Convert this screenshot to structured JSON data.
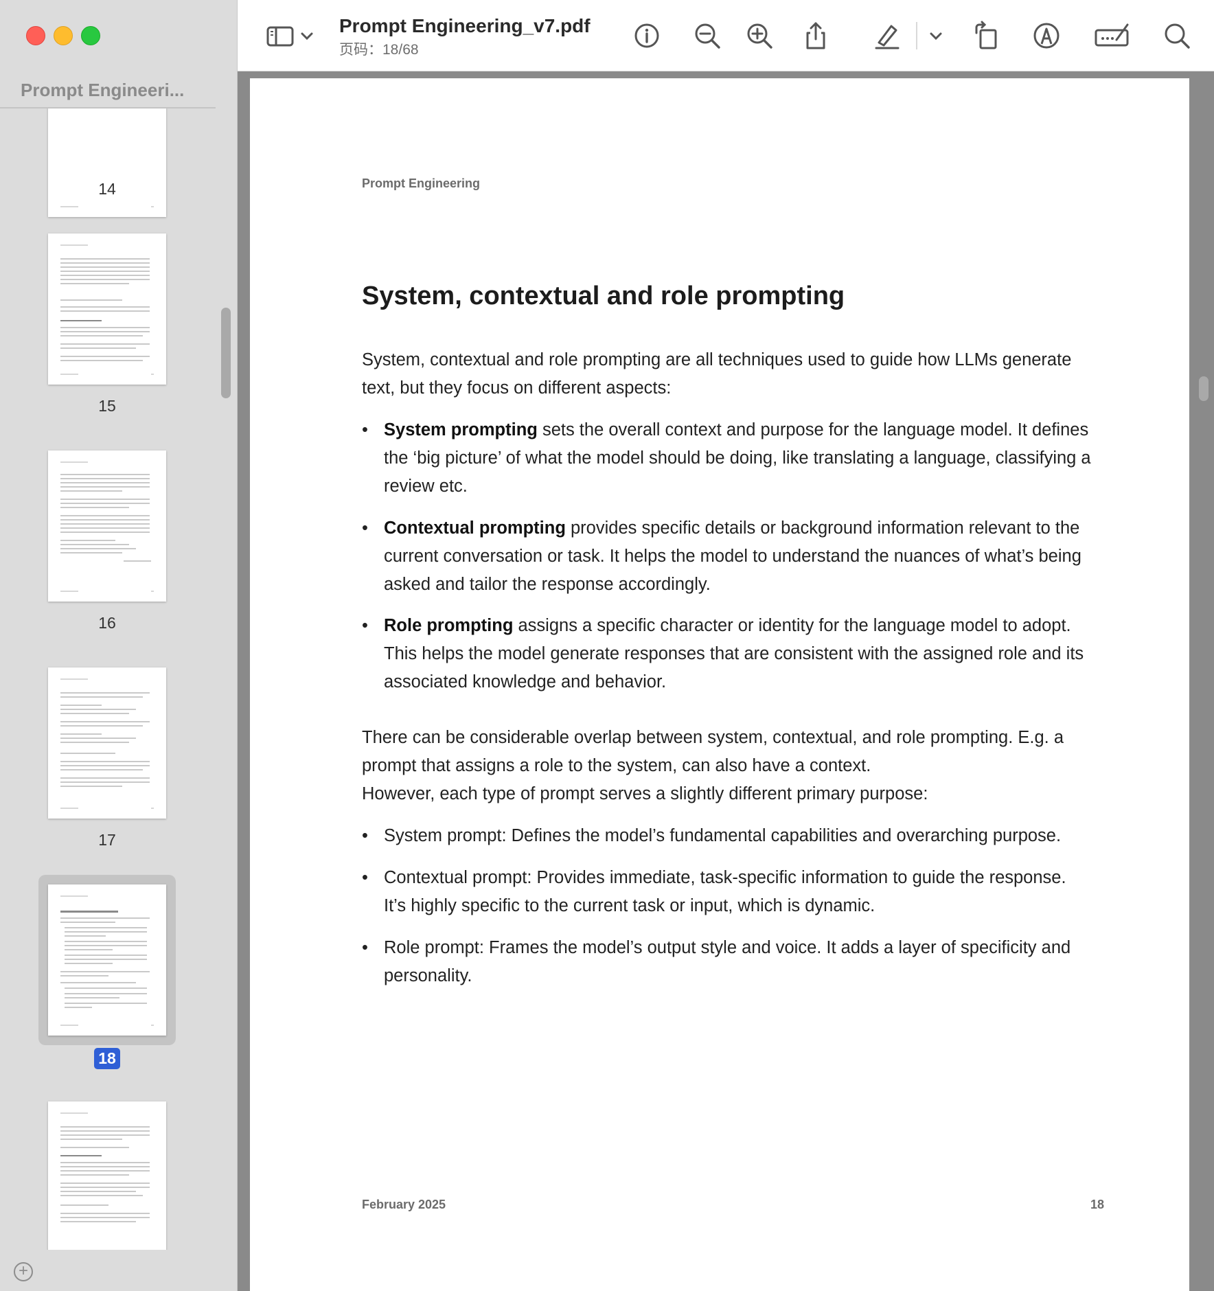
{
  "window": {
    "title": "Prompt Engineering_v7.pdf",
    "page_indicator": "页码：18/68"
  },
  "sidebar": {
    "title": "Prompt Engineeri...",
    "thumbnails": [
      {
        "label": "14",
        "selected": false
      },
      {
        "label": "15",
        "selected": false
      },
      {
        "label": "16",
        "selected": false
      },
      {
        "label": "17",
        "selected": false
      },
      {
        "label": "18",
        "selected": true
      },
      {
        "label": "",
        "selected": false
      }
    ]
  },
  "toolbar": {
    "icons": [
      "sidebar-toggle-icon",
      "chevron-down-icon",
      "info-icon",
      "zoom-out-icon",
      "zoom-in-icon",
      "share-icon",
      "highlight-pen-icon",
      "chevron-down-icon",
      "rotate-icon",
      "markup-icon",
      "signature-icon",
      "search-icon"
    ]
  },
  "page": {
    "header": "Prompt Engineering",
    "heading": "System, contextual and role prompting",
    "intro": "System, contextual and role prompting are all techniques used to guide how LLMs generate text, but they focus on different aspects:",
    "bullets": [
      {
        "bold": "System prompting",
        "text": " sets the overall context and purpose for the language model. It defines the ‘big picture’ of what the model should be doing, like translating a language, classifying a review etc."
      },
      {
        "bold": "Contextual prompting",
        "text": " provides specific details or background information relevant to the current conversation or task. It helps the model to understand the nuances of what’s being asked and tailor the response accordingly."
      },
      {
        "bold": "Role prompting",
        "text": " assigns a specific character or identity for the language model to adopt. This helps the model generate responses that are consistent with the assigned role and its associated knowledge and behavior."
      }
    ],
    "overlap": "There can be considerable overlap between system, contextual, and role prompting. E.g. a prompt that assigns a role to the system, can also have a context.",
    "however": "However, each type of prompt serves a slightly different primary purpose:",
    "purposes": [
      "System prompt: Defines the model’s fundamental capabilities and overarching purpose.",
      "Contextual prompt: Provides immediate, task-specific information to guide the response. It’s highly specific to the current task or input, which is dynamic.",
      "Role prompt: Frames the model’s output style and voice. It adds a layer of specificity and personality."
    ],
    "bullet_char": "•",
    "footer": "February 2025",
    "page_number": "18"
  },
  "colors": {
    "selection": "#2f5fd6",
    "sidebar_bg": "#dcdcdc",
    "close": "#ff5f57",
    "minimize": "#febc2e",
    "zoom": "#28c840"
  }
}
